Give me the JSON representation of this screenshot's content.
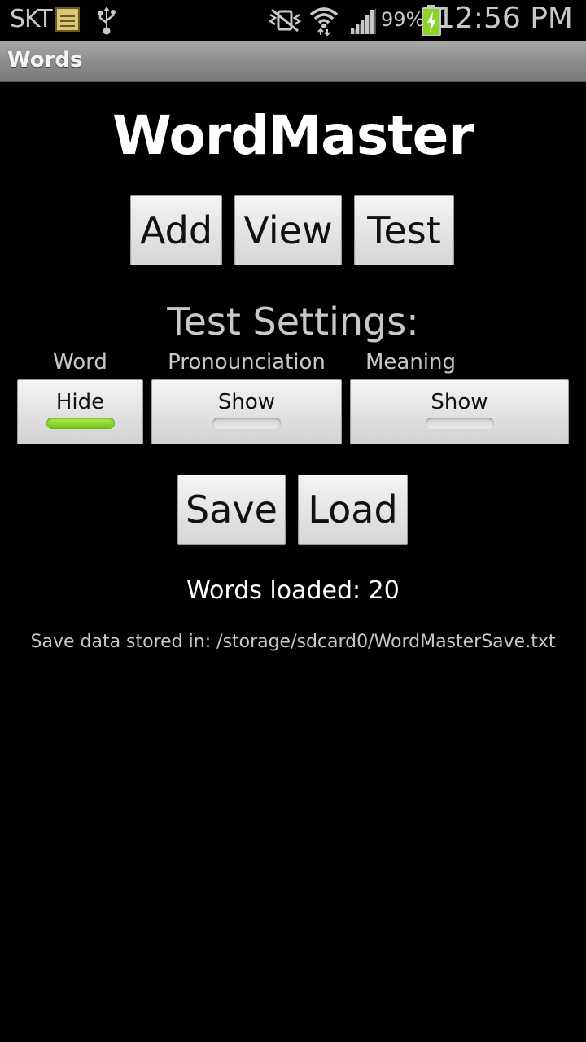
{
  "status_bar": {
    "carrier": "SKT",
    "battery_percent": "99%",
    "time": "12:56 PM"
  },
  "title_bar": {
    "title": "Words"
  },
  "app": {
    "title": "WordMaster",
    "buttons": {
      "add": "Add",
      "view": "View",
      "test": "Test"
    },
    "test_settings": {
      "heading": "Test Settings:",
      "columns": [
        {
          "label": "Word",
          "toggle_label": "Hide",
          "enabled": true
        },
        {
          "label": "Pronounciation",
          "toggle_label": "Show",
          "enabled": false
        },
        {
          "label": "Meaning",
          "toggle_label": "Show",
          "enabled": false
        }
      ]
    },
    "storage_buttons": {
      "save": "Save",
      "load": "Load"
    },
    "words_loaded": "Words loaded: 20",
    "save_path": "Save data stored in: /storage/sdcard0/WordMasterSave.txt"
  },
  "colors": {
    "toggle_on": "#7fd62a",
    "toggle_off": "#d8d8d8",
    "background": "#000000",
    "title_bar": "#8e8e8e"
  }
}
